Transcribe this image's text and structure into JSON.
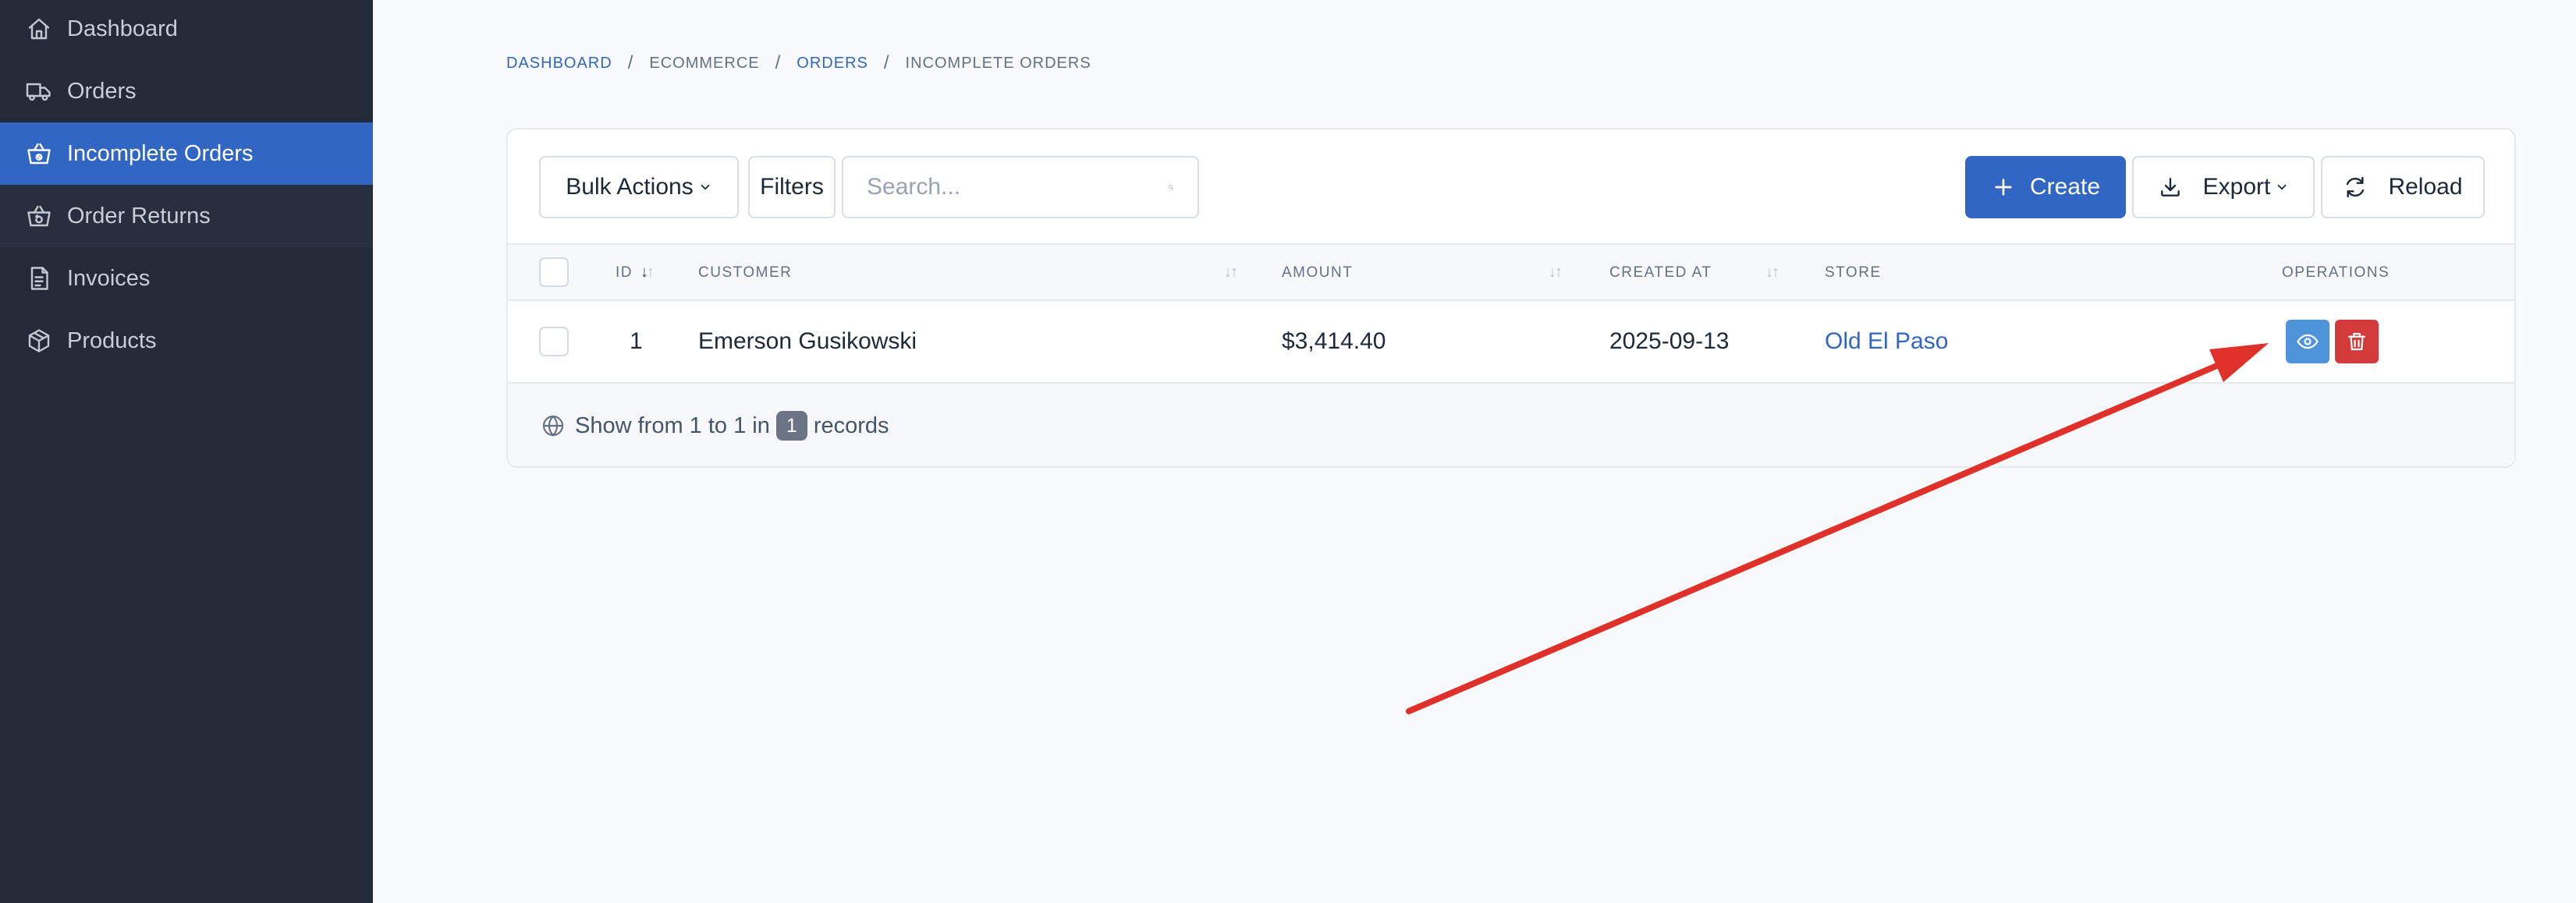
{
  "sidebar": {
    "items": [
      {
        "label": "Dashboard",
        "icon": "home-icon"
      },
      {
        "label": "Orders",
        "icon": "truck-icon"
      },
      {
        "label": "Incomplete Orders",
        "icon": "basket-icon"
      },
      {
        "label": "Order Returns",
        "icon": "basket-return-icon"
      },
      {
        "label": "Invoices",
        "icon": "invoice-icon"
      },
      {
        "label": "Products",
        "icon": "package-icon"
      }
    ],
    "active": "Incomplete Orders"
  },
  "breadcrumb": {
    "items": [
      "DASHBOARD",
      "ECOMMERCE",
      "ORDERS",
      "INCOMPLETE ORDERS"
    ],
    "separator": "/"
  },
  "toolbar": {
    "bulk_actions_label": "Bulk Actions",
    "filters_label": "Filters",
    "search_placeholder": "Search...",
    "create_label": "Create",
    "export_label": "Export",
    "reload_label": "Reload"
  },
  "table": {
    "headers": {
      "id": "ID",
      "customer": "CUSTOMER",
      "amount": "AMOUNT",
      "created_at": "CREATED AT",
      "store": "STORE",
      "operations": "OPERATIONS"
    },
    "rows": [
      {
        "id": "1",
        "customer": "Emerson Gusikowski",
        "amount": "$3,414.40",
        "created_at": "2025-09-13",
        "store": "Old El Paso"
      }
    ]
  },
  "footer": {
    "prefix": "Show from 1 to 1 in",
    "count": "1",
    "suffix": "records"
  },
  "colors": {
    "sidebar_bg": "#232a38",
    "accent": "#3266c3",
    "view_button": "#4f93d9",
    "delete_button": "#d33b3b",
    "annotation_arrow": "#e0302a"
  }
}
